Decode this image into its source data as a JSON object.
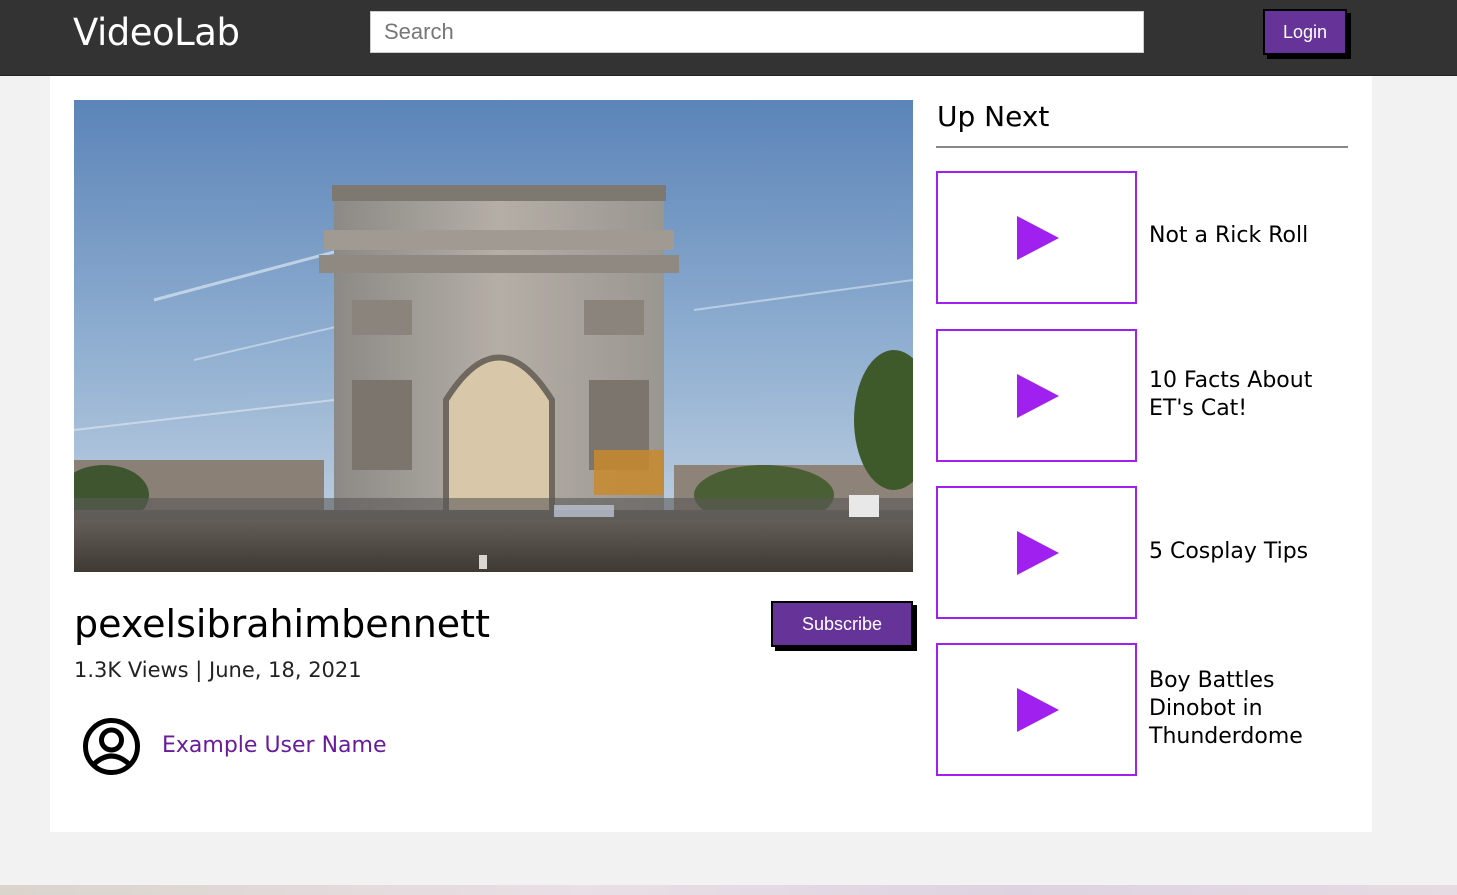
{
  "header": {
    "logo": "VideoLab",
    "search_placeholder": "Search",
    "login_label": "Login"
  },
  "video": {
    "title": "pexelsibrahimbennett",
    "meta": "1.3K Views | June, 18, 2021",
    "subscribe_label": "Subscribe",
    "user_name": "Example User Name"
  },
  "up_next": {
    "heading": "Up Next",
    "items": [
      {
        "label": "Not a Rick Roll"
      },
      {
        "label": "10 Facts About ET's Cat!"
      },
      {
        "label": "5 Cosplay Tips"
      },
      {
        "label": "Boy Battles Dinobot in Thunderdome"
      }
    ]
  },
  "colors": {
    "accent": "#663399",
    "play_icon": "#a020f0",
    "header_bg": "#333333"
  },
  "icons": {
    "thumbnail": "play-icon",
    "avatar": "user-avatar-icon"
  }
}
